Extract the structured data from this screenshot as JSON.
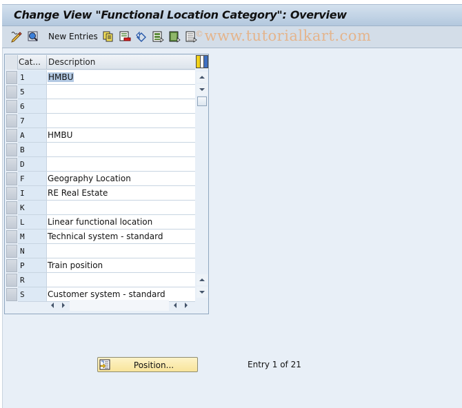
{
  "title": "Change View \"Functional Location Category\": Overview",
  "toolbar": {
    "items": [
      {
        "icon": "display-change-icon",
        "label": ""
      },
      {
        "icon": "search-icon",
        "label": ""
      },
      {
        "icon": "",
        "label": "New Entries"
      },
      {
        "icon": "copy-icon",
        "label": ""
      },
      {
        "icon": "delete-icon",
        "label": ""
      },
      {
        "icon": "undo-change-icon",
        "label": ""
      },
      {
        "icon": "select-all-icon",
        "label": ""
      },
      {
        "icon": "select-block-icon",
        "label": ""
      },
      {
        "icon": "deselect-all-icon",
        "label": ""
      }
    ],
    "new_entries_label": "New Entries"
  },
  "watermark": {
    "symbol": "©",
    "text": "www.tutorialkart.com"
  },
  "table": {
    "columns": [
      "Cat...",
      "Description"
    ],
    "rows": [
      {
        "category": "1",
        "description": "HMBU",
        "selected_text": true
      },
      {
        "category": "5",
        "description": ""
      },
      {
        "category": "6",
        "description": ""
      },
      {
        "category": "7",
        "description": ""
      },
      {
        "category": "A",
        "description": "HMBU"
      },
      {
        "category": "B",
        "description": ""
      },
      {
        "category": "D",
        "description": ""
      },
      {
        "category": "F",
        "description": "Geography Location"
      },
      {
        "category": "I",
        "description": "RE Real Estate"
      },
      {
        "category": "K",
        "description": ""
      },
      {
        "category": "L",
        "description": "Linear functional location"
      },
      {
        "category": "M",
        "description": "Technical system - standard"
      },
      {
        "category": "N",
        "description": ""
      },
      {
        "category": "P",
        "description": "Train position"
      },
      {
        "category": "R",
        "description": ""
      },
      {
        "category": "S",
        "description": "Customer system - standard"
      }
    ]
  },
  "footer": {
    "position_button_label": "Position...",
    "entry_info": "Entry 1 of 21"
  },
  "colors": {
    "title_gradient_top": "#d4e1ee",
    "title_gradient_bottom": "#b3c8de",
    "background": "#e8eff7",
    "button_yellow": "#f8e49a",
    "watermark": "#e8ae7c",
    "selection": "#b3c9e3"
  }
}
